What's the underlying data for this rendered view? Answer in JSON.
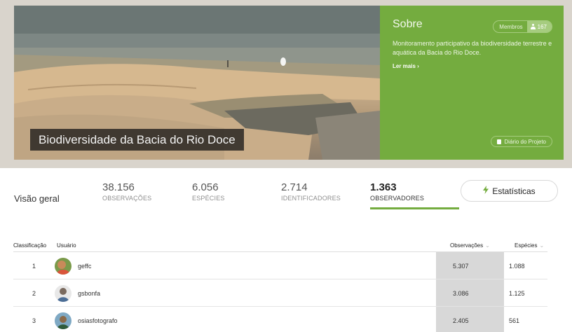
{
  "project": {
    "title": "Biodiversidade da Bacia do Rio Doce",
    "about_title": "Sobre",
    "members_label": "Membros",
    "members_count": "167",
    "description": "Monitoramento participativo da biodiversidade terrestre e aquática da Bacia do Rio Doce.",
    "read_more": "Ler mais ›",
    "journal_label": "Diário do Projeto",
    "accent_color": "#74ac3f"
  },
  "overview": {
    "title": "Visão geral",
    "stats": [
      {
        "value": "38.156",
        "label": "OBSERVAÇÕES"
      },
      {
        "value": "6.056",
        "label": "ESPÉCIES"
      },
      {
        "value": "2.714",
        "label": "IDENTIFICADORES"
      },
      {
        "value": "1.363",
        "label": "OBSERVADORES"
      }
    ],
    "statistics_button": "Estatísticas",
    "statistics_icon": "bolt-icon"
  },
  "table": {
    "headers": {
      "rank": "Classificação",
      "user": "Usuário",
      "observations": "Observações",
      "species": "Espécies"
    },
    "rows": [
      {
        "rank": "1",
        "user": "geffc",
        "observations": "5.307",
        "species": "1.088"
      },
      {
        "rank": "2",
        "user": "gsbonfa",
        "observations": "3.086",
        "species": "1.125"
      },
      {
        "rank": "3",
        "user": "osiasfotografo",
        "observations": "2.405",
        "species": "561"
      }
    ]
  }
}
